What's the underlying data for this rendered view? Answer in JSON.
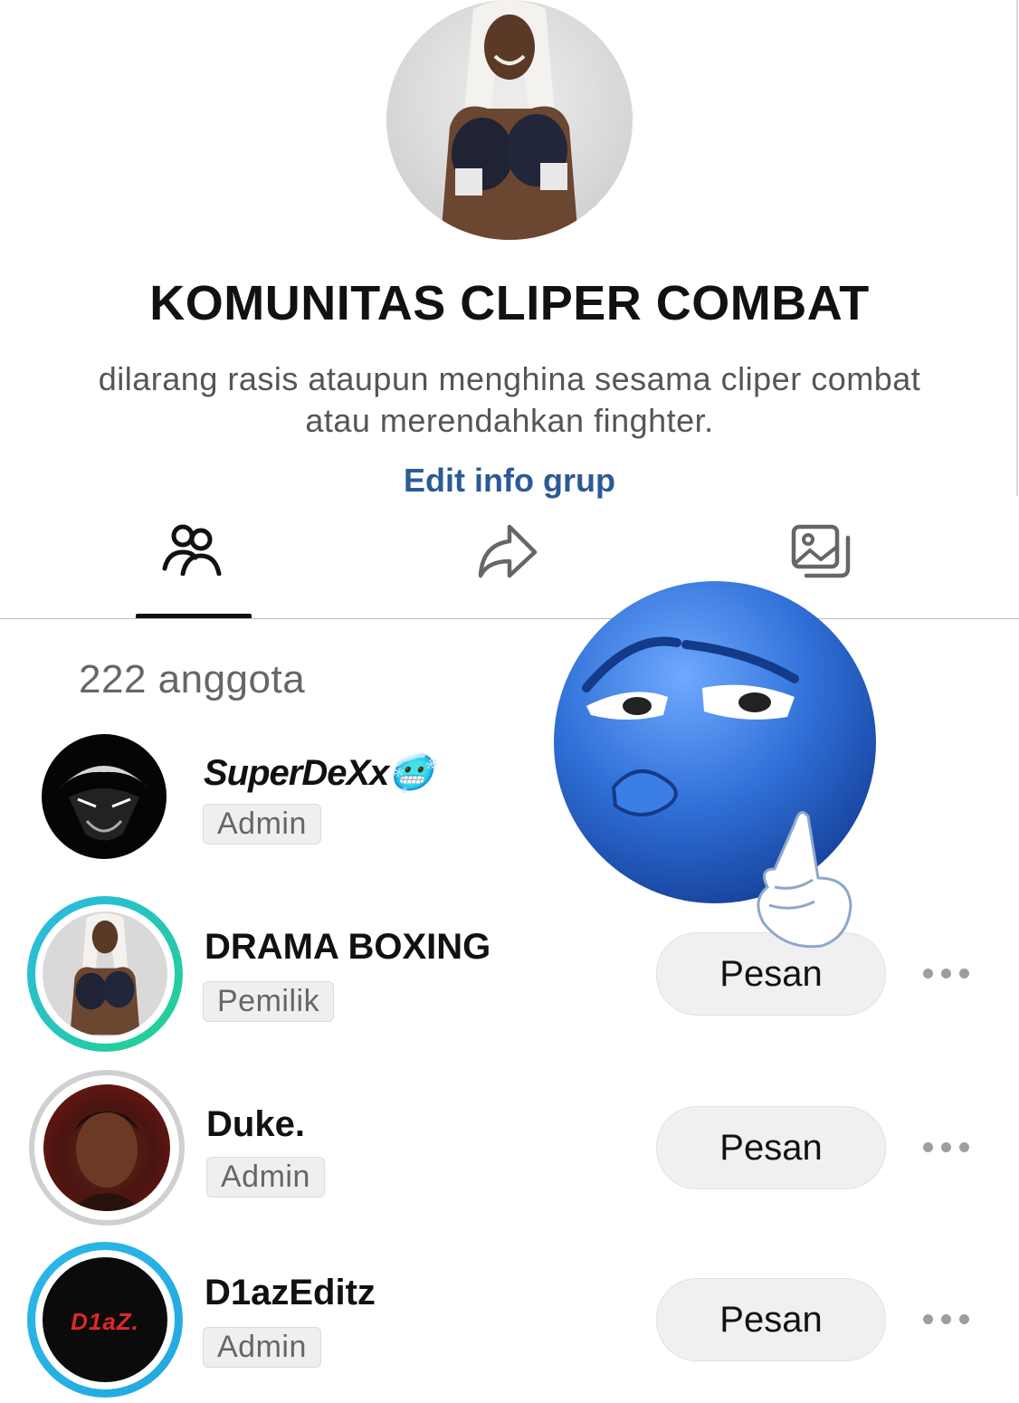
{
  "group": {
    "title": "KOMUNITAS CLIPER COMBAT",
    "description_line1": "dilarang rasis ataupun menghina sesama cliper combat",
    "description_line2": "atau merendahkan finghter.",
    "edit_label": "Edit info grup"
  },
  "tabs": [
    {
      "icon": "members-icon",
      "active": true
    },
    {
      "icon": "share-icon",
      "active": false
    },
    {
      "icon": "media-icon",
      "active": false
    }
  ],
  "member_count": "222 anggota",
  "members": [
    {
      "name": "SuperDeXx",
      "emoji": "🥶",
      "role": "Admin",
      "has_message_button": false
    },
    {
      "name": "DRAMA BOXING",
      "role": "Pemilik",
      "message_label": "Pesan"
    },
    {
      "name": "Duke.",
      "role": "Admin",
      "message_label": "Pesan"
    },
    {
      "name": "D1azEditz",
      "role": "Admin",
      "message_label": "Pesan",
      "avatar_text": "D1aZ."
    }
  ],
  "colors": {
    "link": "#2b5a96",
    "story_ring_start": "#2bb8e8",
    "story_ring_end": "#22d38a",
    "seen_ring": "#d0d0d0",
    "sticker_blue": "#2f6fd6"
  }
}
